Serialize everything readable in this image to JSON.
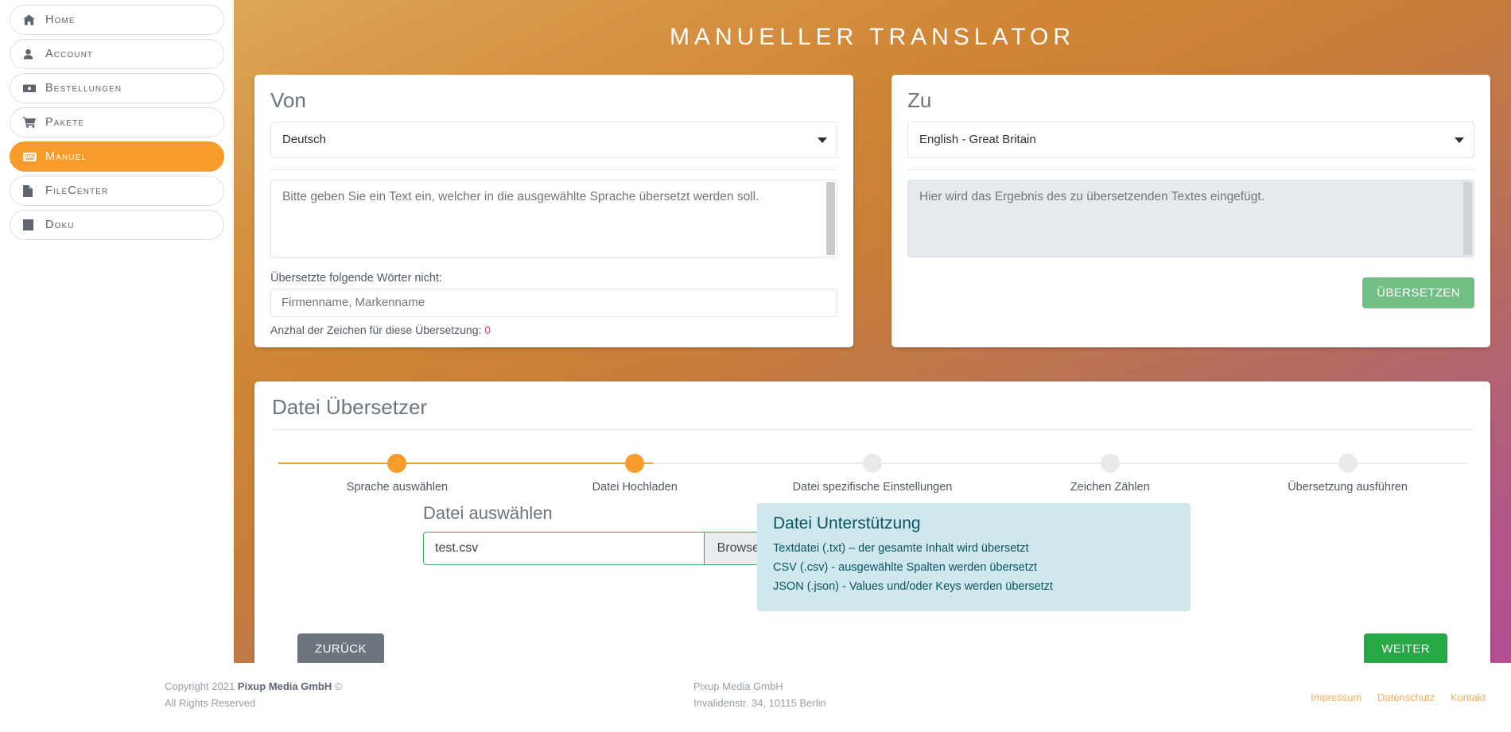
{
  "sidebar": {
    "items": [
      {
        "label": "Home",
        "icon": "home-icon",
        "active": false
      },
      {
        "label": "Account",
        "icon": "user-icon",
        "active": false
      },
      {
        "label": "Bestellungen",
        "icon": "briefcase-icon",
        "active": false
      },
      {
        "label": "Pakete",
        "icon": "shopping-cart-icon",
        "active": false
      },
      {
        "label": "Manuel",
        "icon": "keyboard-icon",
        "active": true
      },
      {
        "label": "FileCenter",
        "icon": "file-icon",
        "active": false
      },
      {
        "label": "Doku",
        "icon": "book-icon",
        "active": false
      }
    ]
  },
  "header": {
    "title": "Manueller Translator"
  },
  "von": {
    "heading": "Von",
    "language_selected": "Deutsch",
    "source_placeholder": "Bitte geben Sie ein Text ein, welcher in die ausgewählte Sprache übersetzt werden soll.",
    "exclude_label": "Übersetzte folgende Wörter nicht:",
    "exclude_placeholder": "Firmenname, Markenname",
    "count_label": "Anzhal der Zeichen für diese Übersetzung:",
    "count_value": "0"
  },
  "zu": {
    "heading": "Zu",
    "language_selected": "English - Great Britain",
    "result_placeholder": "Hier wird das Ergebnis des zu übersetzenden Textes eingefügt.",
    "translate_button": "ÜBERSETZEN"
  },
  "file_translator": {
    "heading": "Datei Übersetzer",
    "steps": [
      {
        "label": "Sprache auswählen",
        "state": "done"
      },
      {
        "label": "Datei Hochladen",
        "state": "done"
      },
      {
        "label": "Datei spezifische Einstellungen",
        "state": "pending"
      },
      {
        "label": "Zeichen Zählen",
        "state": "pending"
      },
      {
        "label": "Übersetzung ausführen",
        "state": "pending"
      }
    ],
    "choose_file_heading": "Datei auswählen",
    "file_name": "test.csv",
    "browse_label": "Browse",
    "support": {
      "title": "Datei Unterstützung",
      "lines": [
        "Textdatei (.txt) – der gesamte Inhalt wird übersetzt",
        "CSV (.csv) - ausgewählte Spalten werden übersetzt",
        "JSON (.json) - Values und/oder Keys werden übersetzt"
      ]
    },
    "back_button": "ZURÜCK",
    "next_button": "WEITER"
  },
  "footer": {
    "copyright_prefix": "Copyright 2021 ",
    "company_bold": "Pixup Media GmbH",
    "copyright_suffix": " ©",
    "rights": "All Rights Reserved",
    "company": "Pixup Media GmbH",
    "address": "Invalidenstr. 34, 10115 Berlin",
    "links": [
      "Impressum",
      "Datenschutz",
      "Kontakt"
    ]
  },
  "colors": {
    "accent_orange": "#f79c2a",
    "translate_green": "#71bf84",
    "next_green": "#28a745",
    "back_grey": "#6c757d",
    "info_blue_bg": "#cfe8ef",
    "info_blue_text": "#0c5460",
    "count_red": "#e0396b"
  }
}
